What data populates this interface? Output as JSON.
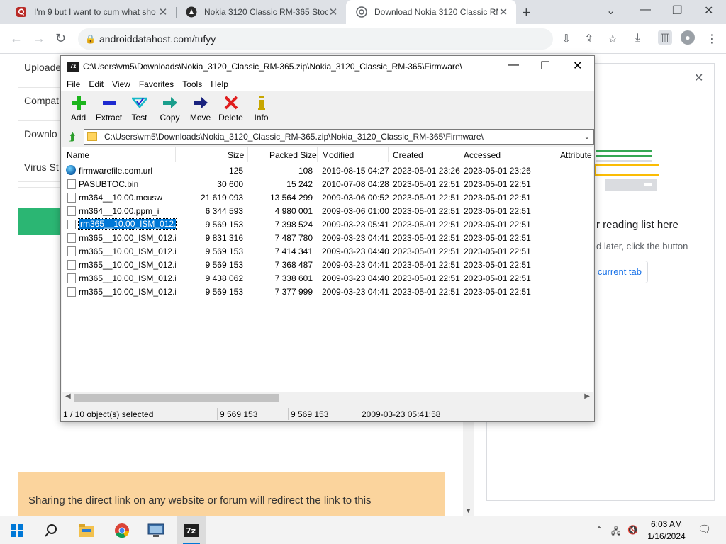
{
  "browser": {
    "tabs": [
      {
        "title": "I'm 9 but I want to cum what sho",
        "favicon": "quora-icon"
      },
      {
        "title": "Nokia 3120 Classic RM-365 Stock",
        "favicon": "site-icon"
      },
      {
        "title": "Download Nokia 3120 Classic RM",
        "favicon": "site-icon",
        "active": true
      }
    ],
    "url": "androiddatahost.com/tufyy"
  },
  "page": {
    "info_labels": [
      "Uploade",
      "Compat",
      "Downlo",
      "Virus St"
    ],
    "notice_text": "Sharing the direct link on any website or forum will redirect the link to this"
  },
  "side_panel": {
    "title": "r reading list here",
    "subtitle": "d later, click the button",
    "button_label": "current tab"
  },
  "zip": {
    "title": "C:\\Users\\vm5\\Downloads\\Nokia_3120_Classic_RM-365.zip\\Nokia_3120_Classic_RM-365\\Firmware\\",
    "menu": [
      "File",
      "Edit",
      "View",
      "Favorites",
      "Tools",
      "Help"
    ],
    "toolbar": [
      {
        "label": "Add",
        "icon": "add-icon",
        "color": "#1cb51c"
      },
      {
        "label": "Extract",
        "icon": "extract-icon",
        "color": "#1e2ad0"
      },
      {
        "label": "Test",
        "icon": "test-icon",
        "color": "#14b8c8"
      },
      {
        "label": "Copy",
        "icon": "copy-icon",
        "color": "#1a9e8c"
      },
      {
        "label": "Move",
        "icon": "move-icon",
        "color": "#1a237e"
      },
      {
        "label": "Delete",
        "icon": "delete-icon",
        "color": "#e01e1e"
      },
      {
        "label": "Info",
        "icon": "info-icon",
        "color": "#c7a600"
      }
    ],
    "address": "C:\\Users\\vm5\\Downloads\\Nokia_3120_Classic_RM-365.zip\\Nokia_3120_Classic_RM-365\\Firmware\\",
    "columns": [
      "Name",
      "Size",
      "Packed Size",
      "Modified",
      "Created",
      "Accessed",
      "Attribute"
    ],
    "rows": [
      {
        "name": "firmwarefile.com.url",
        "size": "125",
        "packed": "108",
        "modified": "2019-08-15 04:27",
        "created": "2023-05-01 23:26",
        "accessed": "2023-05-01 23:26",
        "icon": "globe"
      },
      {
        "name": "PASUBTOC.bin",
        "size": "30 600",
        "packed": "15 242",
        "modified": "2010-07-08 04:28",
        "created": "2023-05-01 22:51",
        "accessed": "2023-05-01 22:51"
      },
      {
        "name": "rm364__10.00.mcusw",
        "size": "21 619 093",
        "packed": "13 564 299",
        "modified": "2009-03-06 00:52",
        "created": "2023-05-01 22:51",
        "accessed": "2023-05-01 22:51"
      },
      {
        "name": "rm364__10.00.ppm_i",
        "size": "6 344 593",
        "packed": "4 980 001",
        "modified": "2009-03-06 01:00",
        "created": "2023-05-01 22:51",
        "accessed": "2023-05-01 22:51"
      },
      {
        "name": "rm365__10.00_ISM_012.i...",
        "size": "9 569 153",
        "packed": "7 398 524",
        "modified": "2009-03-23 05:41",
        "created": "2023-05-01 22:51",
        "accessed": "2023-05-01 22:51",
        "selected": true
      },
      {
        "name": "rm365__10.00_ISM_012.i...",
        "size": "9 831 316",
        "packed": "7 487 780",
        "modified": "2009-03-23 04:41",
        "created": "2023-05-01 22:51",
        "accessed": "2023-05-01 22:51"
      },
      {
        "name": "rm365__10.00_ISM_012.i...",
        "size": "9 569 153",
        "packed": "7 414 341",
        "modified": "2009-03-23 04:40",
        "created": "2023-05-01 22:51",
        "accessed": "2023-05-01 22:51"
      },
      {
        "name": "rm365__10.00_ISM_012.i...",
        "size": "9 569 153",
        "packed": "7 368 487",
        "modified": "2009-03-23 04:41",
        "created": "2023-05-01 22:51",
        "accessed": "2023-05-01 22:51"
      },
      {
        "name": "rm365__10.00_ISM_012.i...",
        "size": "9 438 062",
        "packed": "7 338 601",
        "modified": "2009-03-23 04:40",
        "created": "2023-05-01 22:51",
        "accessed": "2023-05-01 22:51"
      },
      {
        "name": "rm365__10.00_ISM_012.i...",
        "size": "9 569 153",
        "packed": "7 377 999",
        "modified": "2009-03-23 04:41",
        "created": "2023-05-01 22:51",
        "accessed": "2023-05-01 22:51"
      }
    ],
    "status": {
      "selection": "1 / 10 object(s) selected",
      "size": "9 569 153",
      "packed": "9 569 153",
      "modified": "2009-03-23 05:41:58"
    }
  },
  "taskbar": {
    "time": "6:03 AM",
    "date": "1/16/2024"
  }
}
